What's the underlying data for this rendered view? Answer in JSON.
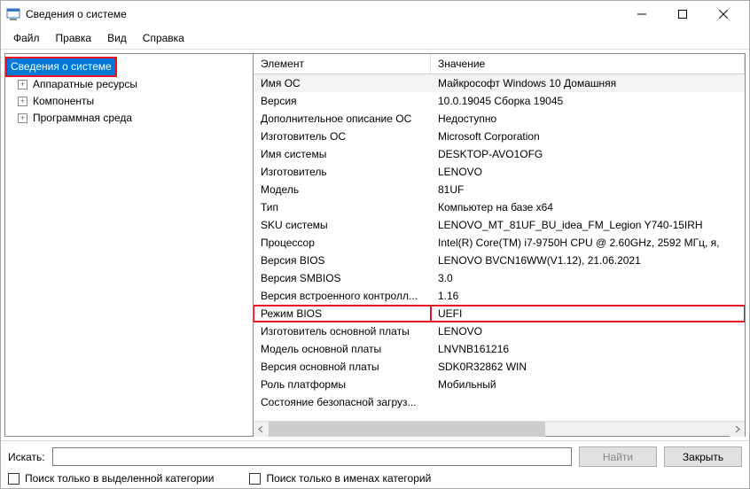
{
  "window": {
    "title": "Сведения о системе"
  },
  "menu": {
    "file": "Файл",
    "edit": "Правка",
    "view": "Вид",
    "help": "Справка"
  },
  "tree": {
    "root": "Сведения о системе",
    "items": [
      {
        "label": "Аппаратные ресурсы"
      },
      {
        "label": "Компоненты"
      },
      {
        "label": "Программная среда"
      }
    ]
  },
  "columns": {
    "element": "Элемент",
    "value": "Значение"
  },
  "rows": [
    {
      "el": "Имя ОС",
      "val": "Майкрософт Windows 10 Домашняя",
      "alt": true
    },
    {
      "el": "Версия",
      "val": "10.0.19045 Сборка 19045"
    },
    {
      "el": "Дополнительное описание ОС",
      "val": "Недоступно"
    },
    {
      "el": "Изготовитель ОС",
      "val": "Microsoft Corporation"
    },
    {
      "el": "Имя системы",
      "val": "DESKTOP-AVO1OFG"
    },
    {
      "el": "Изготовитель",
      "val": "LENOVO"
    },
    {
      "el": "Модель",
      "val": "81UF"
    },
    {
      "el": "Тип",
      "val": "Компьютер на базе x64"
    },
    {
      "el": "SKU системы",
      "val": "LENOVO_MT_81UF_BU_idea_FM_Legion Y740-15IRH"
    },
    {
      "el": "Процессор",
      "val": "Intel(R) Core(TM) i7-9750H CPU @ 2.60GHz, 2592 МГц, я,"
    },
    {
      "el": "Версия BIOS",
      "val": "LENOVO BVCN16WW(V1.12), 21.06.2021"
    },
    {
      "el": "Версия SMBIOS",
      "val": "3.0"
    },
    {
      "el": "Версия встроенного контролл...",
      "val": "1.16"
    },
    {
      "el": "Режим BIOS",
      "val": "UEFI",
      "highlight": true
    },
    {
      "el": "Изготовитель основной платы",
      "val": "LENOVO"
    },
    {
      "el": "Модель основной платы",
      "val": "LNVNB161216"
    },
    {
      "el": "Версия основной платы",
      "val": "SDK0R32862 WIN"
    },
    {
      "el": "Роль платформы",
      "val": "Мобильный"
    },
    {
      "el": "Состояние безопасной загруз...",
      "val": ""
    }
  ],
  "footer": {
    "search_label": "Искать:",
    "find": "Найти",
    "close": "Закрыть",
    "chk_selected": "Поиск только в выделенной категории",
    "chk_names": "Поиск только в именах категорий"
  }
}
